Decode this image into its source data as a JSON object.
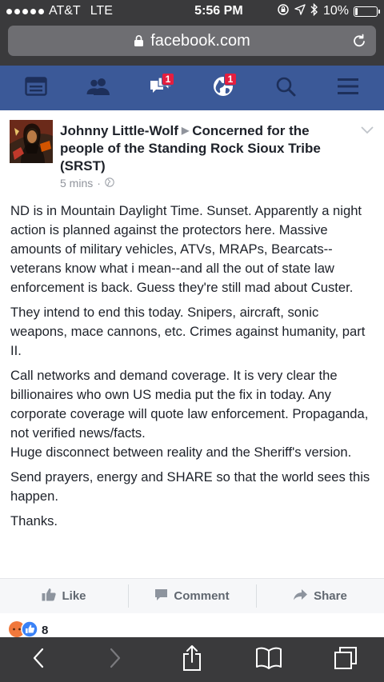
{
  "status_bar": {
    "carrier": "AT&T",
    "network": "LTE",
    "time": "5:56 PM",
    "battery": "10%",
    "battery_level": 0.1
  },
  "browser": {
    "url": "facebook.com"
  },
  "fb_nav": {
    "items": [
      {
        "icon": "news-feed-icon"
      },
      {
        "icon": "friends-icon"
      },
      {
        "icon": "messages-icon",
        "badge": "1"
      },
      {
        "icon": "notifications-globe-icon",
        "badge": "1"
      },
      {
        "icon": "search-icon"
      },
      {
        "icon": "menu-icon"
      }
    ]
  },
  "post": {
    "author": "Johnny Little-Wolf",
    "group": "Concerned for the people of the Standing Rock Sioux Tribe (SRST)",
    "time": "5 mins",
    "paragraphs": [
      "ND is in Mountain Daylight Time. Sunset. Apparently a night action is planned against the protectors here. Massive amounts of military vehicles, ATVs, MRAPs, Bearcats--veterans know what i mean--and all the out of state law enforcement is back. Guess they're still mad about Custer.",
      "They intend to end this today. Snipers, aircraft, sonic weapons, mace cannons, etc. Crimes against humanity, part II.",
      "Call networks and demand coverage. It is very clear the billionaires who own US media put the fix in today. Any corporate coverage will quote law enforcement. Propaganda, not verified news/facts.",
      "Huge disconnect between reality and the Sheriff's version.",
      "Send prayers, energy and SHARE so that the world sees this happen.",
      "Thanks."
    ]
  },
  "actions": {
    "like": "Like",
    "comment": "Comment",
    "share": "Share"
  },
  "reactions": {
    "count": "8"
  },
  "colors": {
    "fb_blue": "#3b5998",
    "badge_red": "#e41e3f",
    "chrome": "#3a3a3c"
  }
}
